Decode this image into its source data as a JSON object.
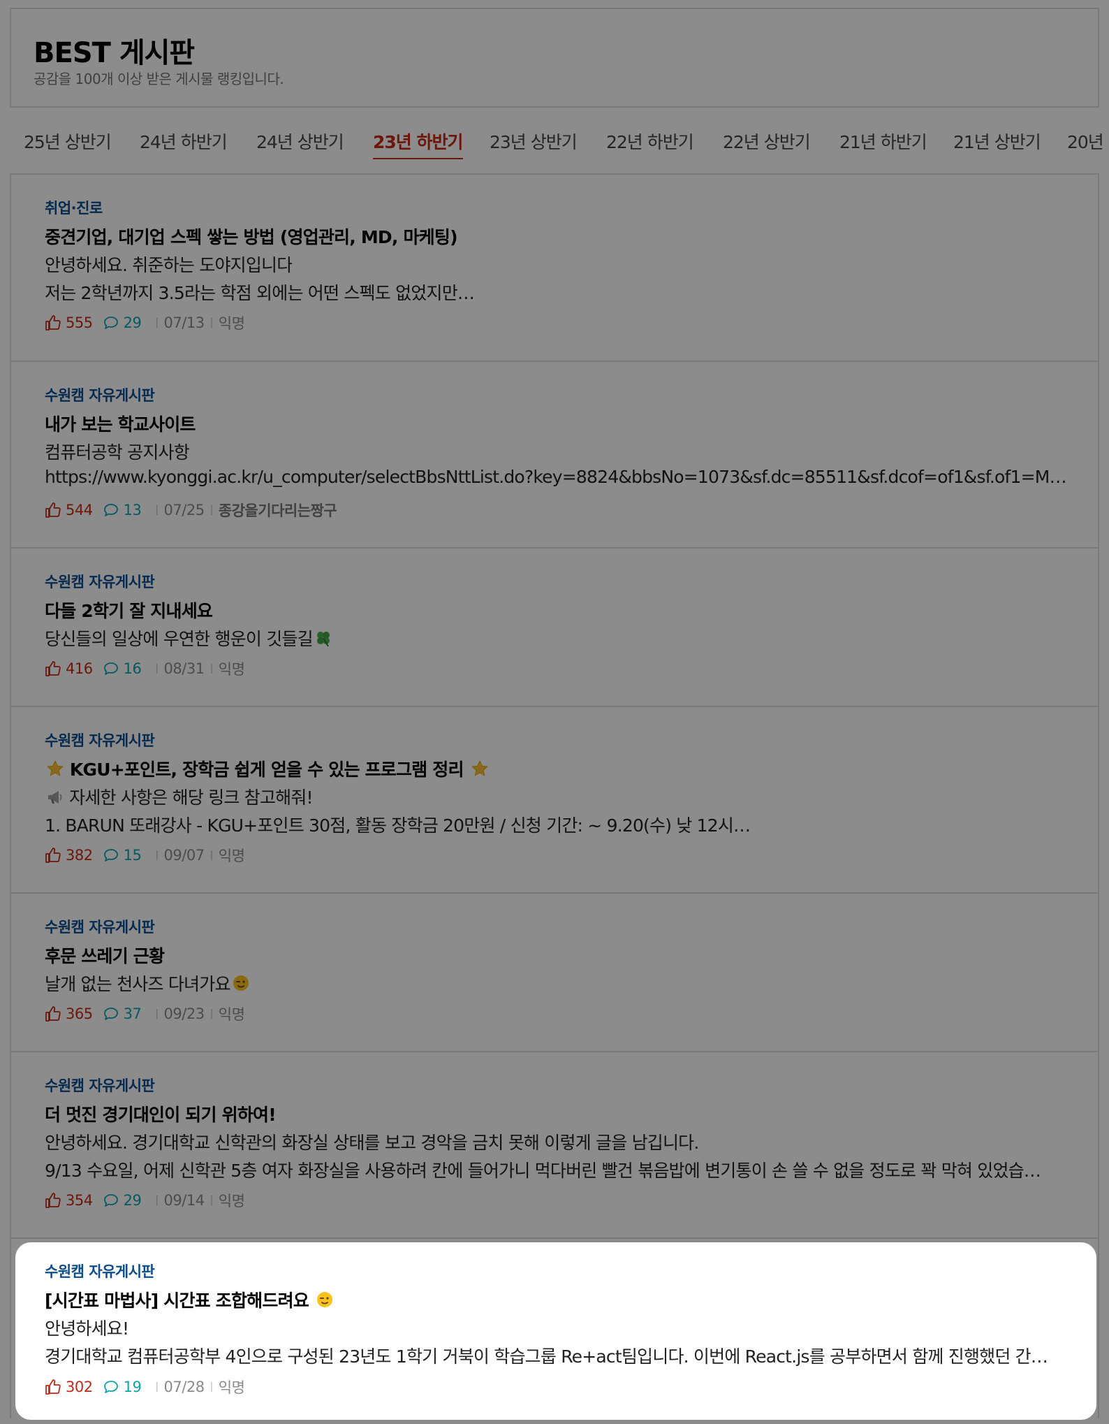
{
  "header": {
    "title": "BEST 게시판",
    "description": "공감을 100개 이상 받은 게시물 랭킹입니다."
  },
  "tabs": [
    {
      "label": "25년 상반기"
    },
    {
      "label": "24년 하반기"
    },
    {
      "label": "24년 상반기"
    },
    {
      "label": "23년 하반기",
      "active": true
    },
    {
      "label": "23년 상반기"
    },
    {
      "label": "22년 하반기"
    },
    {
      "label": "22년 상반기"
    },
    {
      "label": "21년 하반기"
    },
    {
      "label": "21년 상반기"
    },
    {
      "label": "20년"
    }
  ],
  "articles": [
    {
      "board": "취업·진로",
      "title": "중견기업, 대기업 스펙 쌓는 방법 (영업관리, MD, 마케팅)",
      "lines": [
        "안녕하세요. 취준하는 도야지입니다",
        "저는 2학년까지 3.5라는 학점 외에는 어떤 스펙도 없었지만…"
      ],
      "likes": "555",
      "comments": "29",
      "date": "07/13",
      "author": "익명"
    },
    {
      "board": "수원캠 자유게시판",
      "title": "내가 보는 학교사이트",
      "lines": [
        "컴퓨터공학 공지사항",
        "https://www.kyonggi.ac.kr/u_computer/selectBbsNttList.do?key=8824&bbsNo=1073&sf.dc=85511&sf.dcof=of1&sf.of1=M…"
      ],
      "likes": "544",
      "comments": "13",
      "date": "07/25",
      "author": "종강을기다리는짱구"
    },
    {
      "board": "수원캠 자유게시판",
      "title": "다들 2학기 잘 지내세요",
      "lines": [
        "당신들의 일상에 우연한 행운이 깃들길"
      ],
      "likes": "416",
      "comments": "16",
      "date": "08/31",
      "author": "익명"
    },
    {
      "board": "수원캠 자유게시판",
      "title": "KGU+포인트, 장학금 쉽게 얻을 수 있는 프로그램 정리",
      "lines": [
        "자세한 사항은 해당 링크 참고해줘!",
        "1. BARUN 또래강사 - KGU+포인트 30점, 활동 장학금 20만원 / 신청 기간: ~ 9.20(수) 낮 12시…"
      ],
      "likes": "382",
      "comments": "15",
      "date": "09/07",
      "author": "익명"
    },
    {
      "board": "수원캠 자유게시판",
      "title": "후문 쓰레기 근황",
      "lines": [
        "날개 없는 천사즈 다녀가요"
      ],
      "likes": "365",
      "comments": "37",
      "date": "09/23",
      "author": "익명"
    },
    {
      "board": "수원캠 자유게시판",
      "title": "더 멋진 경기대인이 되기 위하여!",
      "lines": [
        "안녕하세요. 경기대학교 신학관의 화장실 상태를 보고 경악을 금치 못해 이렇게 글을 남깁니다.",
        "9/13 수요일, 어제 신학관 5층 여자 화장실을 사용하려 칸에 들어가니 먹다버린 빨건 볶음밥에 변기통이 손 쓸 수 없을 정도로 꽉 막혀 있었습…"
      ],
      "likes": "354",
      "comments": "29",
      "date": "09/14",
      "author": "익명"
    },
    {
      "board": "수원캠 자유게시판",
      "title": "[시간표 마법사] 시간표 조합해드려요",
      "lines": [
        "안녕하세요!",
        "경기대학교 컴퓨터공학부 4인으로 구성된 23년도 1학기 거북이 학습그룹 Re+act팀입니다. 이번에 React.js를 공부하면서 함께 진행했던 간…"
      ],
      "likes": "302",
      "comments": "19",
      "date": "07/28",
      "author": "익명"
    }
  ],
  "colors": {
    "accent_red": "#c62917",
    "board_blue": "#0d4d8e",
    "comment_teal": "#0ca5af"
  }
}
